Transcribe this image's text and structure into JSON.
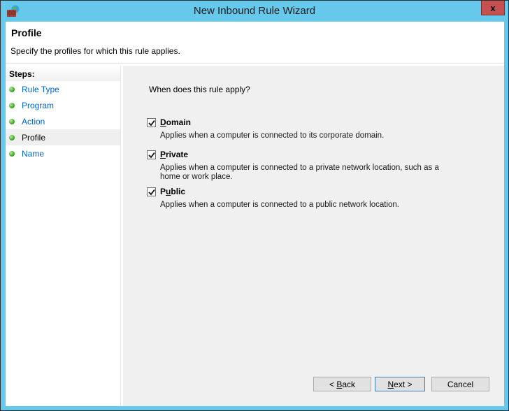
{
  "window": {
    "title": "New Inbound Rule Wizard",
    "app_icon": "firewall-icon",
    "close_label": "x"
  },
  "header": {
    "title": "Profile",
    "subtitle": "Specify the profiles for which this rule applies."
  },
  "steps": {
    "heading": "Steps:",
    "items": [
      {
        "label": "Rule Type",
        "current": false
      },
      {
        "label": "Program",
        "current": false
      },
      {
        "label": "Action",
        "current": false
      },
      {
        "label": "Profile",
        "current": true
      },
      {
        "label": "Name",
        "current": false
      }
    ]
  },
  "content": {
    "question": "When does this rule apply?",
    "options": [
      {
        "label_accel": "D",
        "label_rest": "omain",
        "checked": true,
        "description": "Applies when a computer is connected to its corporate domain."
      },
      {
        "label_accel": "P",
        "label_rest": "rivate",
        "checked": true,
        "description": "Applies when a computer is connected to a private network location, such as a home or work place."
      },
      {
        "label_pre": "P",
        "label_accel": "u",
        "label_rest": "blic",
        "checked": true,
        "description": "Applies when a computer is connected to a public network location."
      }
    ]
  },
  "buttons": {
    "back_pre": "< ",
    "back_accel": "B",
    "back_rest": "ack",
    "next_accel": "N",
    "next_rest": "ext >",
    "cancel": "Cancel"
  },
  "colors": {
    "frame": "#66c8ea",
    "close": "#c75050",
    "link": "#0066cc"
  }
}
